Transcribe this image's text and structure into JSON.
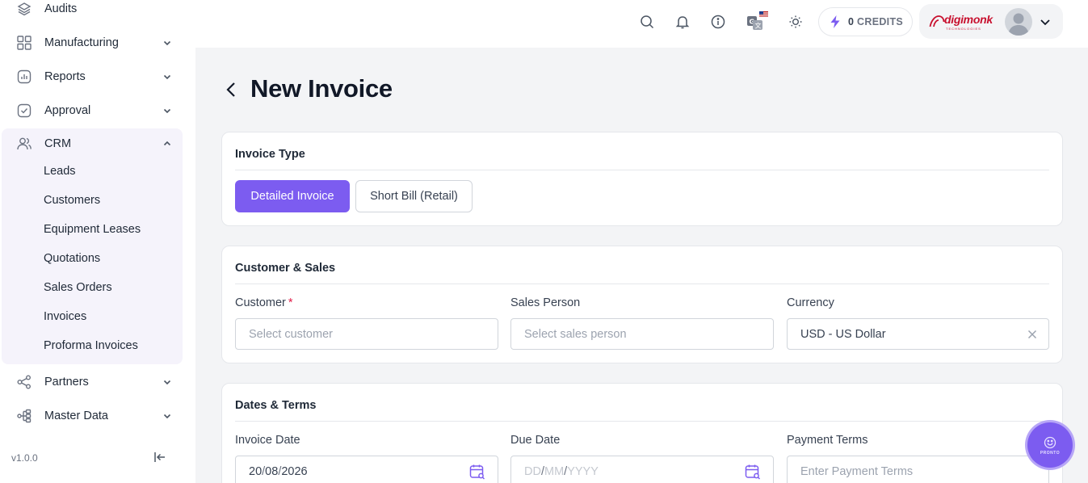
{
  "sidebar": {
    "items": [
      {
        "label": "Audits",
        "icon": "layers-icon"
      },
      {
        "label": "Manufacturing",
        "icon": "grid-icon"
      },
      {
        "label": "Reports",
        "icon": "chart-icon"
      },
      {
        "label": "Approval",
        "icon": "check-square-icon"
      },
      {
        "label": "CRM",
        "icon": "users-icon"
      },
      {
        "label": "Partners",
        "icon": "share-icon"
      },
      {
        "label": "Master Data",
        "icon": "hierarchy-icon"
      }
    ],
    "crm_subitems": [
      "Leads",
      "Customers",
      "Equipment Leases",
      "Quotations",
      "Sales Orders",
      "Invoices",
      "Proforma Invoices"
    ],
    "version": "v1.0.0"
  },
  "topbar": {
    "credits_count": "0",
    "credits_label": "CREDITS",
    "brand_name": "digimonk",
    "brand_tagline": "TECHNOLOGIES",
    "accent": "#7c5cf0"
  },
  "page": {
    "title": "New Invoice"
  },
  "invoice_type": {
    "title": "Invoice Type",
    "options": [
      "Detailed Invoice",
      "Short Bill (Retail)"
    ],
    "selected": "Detailed Invoice"
  },
  "customer_sales": {
    "title": "Customer & Sales",
    "customer_label": "Customer",
    "required_mark": "*",
    "customer_placeholder": "Select customer",
    "sales_person_label": "Sales Person",
    "sales_person_placeholder": "Select sales person",
    "currency_label": "Currency",
    "currency_value": "USD - US Dollar"
  },
  "dates_terms": {
    "title": "Dates & Terms",
    "invoice_date_label": "Invoice Date",
    "invoice_date": {
      "dd": "20",
      "mm": "08",
      "yyyy": "2026"
    },
    "due_date_label": "Due Date",
    "due_date_placeholder": {
      "dd": "DD",
      "mm": "MM",
      "yyyy": "YYYY"
    },
    "date_separator": "/",
    "payment_terms_label": "Payment Terms",
    "payment_terms_placeholder": "Enter Payment Terms"
  },
  "fab": {
    "label": "PRONTO"
  }
}
